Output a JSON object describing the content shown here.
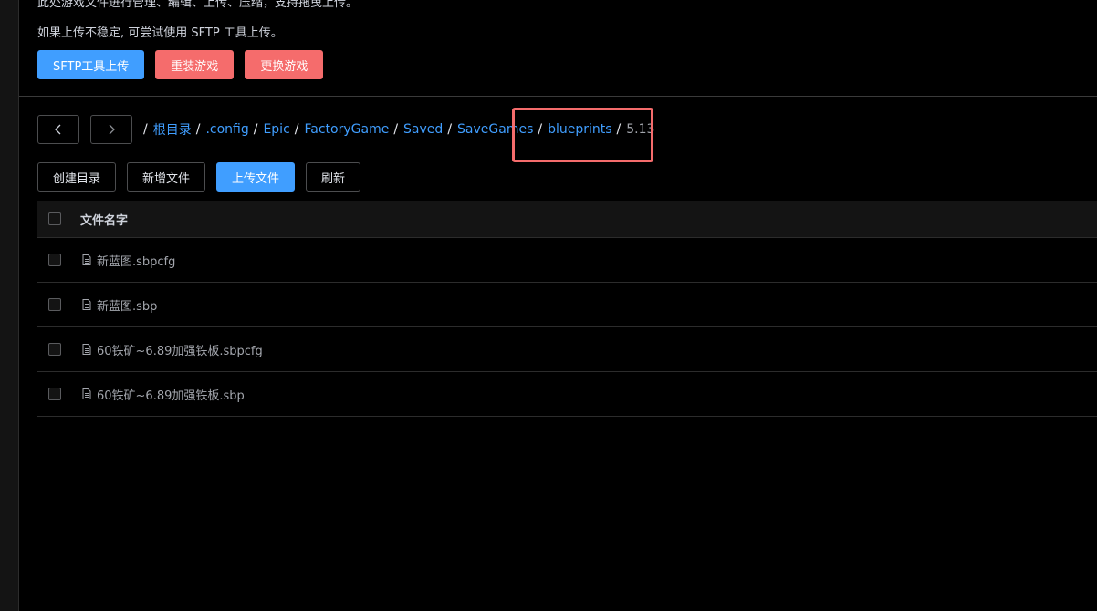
{
  "notice": {
    "line1": "此处游戏文件进行管理、编辑、上传、压缩，支持拖曳上传。",
    "line2": "如果上传不稳定, 可尝试使用 SFTP 工具上传。"
  },
  "top_actions": {
    "sftp_label": "SFTP工具上传",
    "reinstall_label": "重装游戏",
    "change_label": "更换游戏"
  },
  "breadcrumb": {
    "items": [
      "根目录",
      ".config",
      "Epic",
      "FactoryGame",
      "Saved",
      "SaveGames",
      "blueprints"
    ],
    "current": "5.13",
    "separator": "/"
  },
  "file_actions": {
    "create_dir_label": "创建目录",
    "new_file_label": "新增文件",
    "upload_label": "上传文件",
    "refresh_label": "刷新"
  },
  "table": {
    "header": "文件名字",
    "rows": [
      "新蓝图.sbpcfg",
      "新蓝图.sbp",
      "60铁矿~6.89加强铁板.sbpcfg",
      "60铁矿~6.89加强铁板.sbp"
    ]
  },
  "colors": {
    "primary": "#409eff",
    "danger": "#f56c6c",
    "background": "#000000"
  }
}
